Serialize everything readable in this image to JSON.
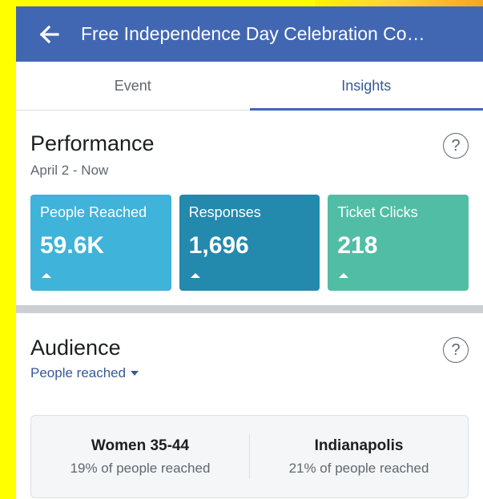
{
  "header": {
    "title": "Free Independence Day Celebration Co…",
    "back_icon": "arrow-left-icon"
  },
  "tabs": [
    {
      "label": "Event",
      "active": false
    },
    {
      "label": "Insights",
      "active": true
    }
  ],
  "performance": {
    "title": "Performance",
    "date_range": "April 2 - Now",
    "help_glyph": "?",
    "cards": [
      {
        "label": "People Reached",
        "value": "59.6K",
        "color": "#3fb3d9",
        "trend_icon": "arrow-up-icon"
      },
      {
        "label": "Responses",
        "value": "1,696",
        "color": "#2389ad",
        "trend_icon": "arrow-up-icon"
      },
      {
        "label": "Ticket Clicks",
        "value": "218",
        "color": "#52bda5",
        "trend_icon": "arrow-up-icon"
      }
    ]
  },
  "audience": {
    "title": "Audience",
    "filter_label": "People reached",
    "help_glyph": "?",
    "summary": [
      {
        "title": "Women 35-44",
        "subtitle": "19% of people reached"
      },
      {
        "title": "Indianapolis",
        "subtitle": "21% of people reached"
      }
    ]
  },
  "colors": {
    "brand": "#4267b2",
    "link": "#385898"
  }
}
